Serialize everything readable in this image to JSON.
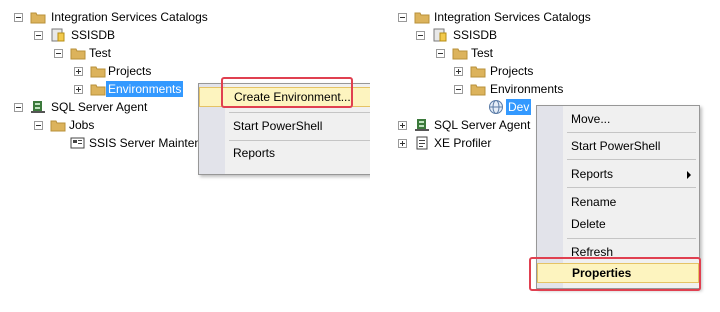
{
  "left_tree": {
    "catalogs": "Integration Services Catalogs",
    "ssisdb": "SSISDB",
    "test": "Test",
    "projects": "Projects",
    "environments": "Environments",
    "agent": "SQL Server Agent",
    "jobs": "Jobs",
    "job1": "SSIS Server Maintena"
  },
  "left_menu": {
    "create_env": "Create Environment...",
    "powershell": "Start PowerShell",
    "reports_partial": "Reports"
  },
  "right_tree": {
    "catalogs": "Integration Services Catalogs",
    "ssisdb": "SSISDB",
    "test": "Test",
    "projects": "Projects",
    "environments": "Environments",
    "dev": "Dev",
    "agent": "SQL Server Agent",
    "profiler": "XE Profiler"
  },
  "right_menu": {
    "move": "Move...",
    "powershell": "Start PowerShell",
    "reports": "Reports",
    "rename": "Rename",
    "delete": "Delete",
    "refresh": "Refresh",
    "properties": "Properties"
  },
  "colors": {
    "selection": "#3399ff",
    "highlight_box": "#e04050",
    "hover": "#fdf4bf",
    "folder": "#dcb35c"
  }
}
